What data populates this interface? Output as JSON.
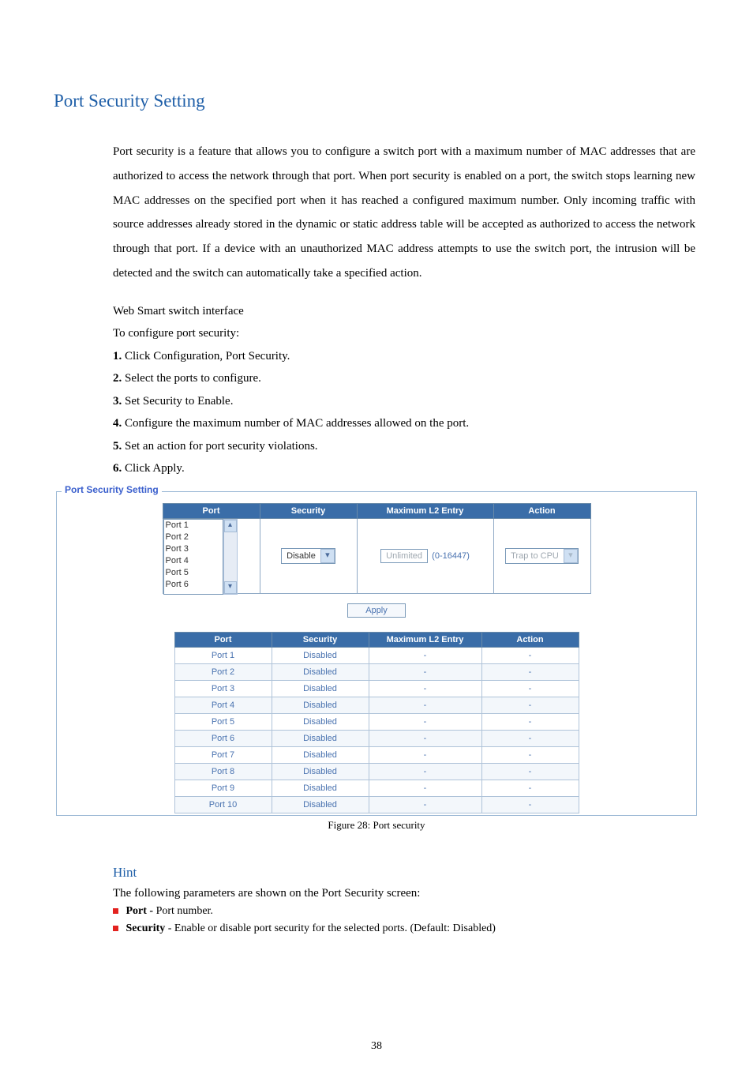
{
  "heading": "Port Security Setting",
  "intro": "Port security is a feature that allows you to configure a switch port with a maximum number of MAC addresses that are authorized to access the network through that port. When port security is enabled on a port, the switch stops learning new MAC addresses on the specified port when it has reached a configured maximum number. Only incoming traffic with source addresses already stored in the dynamic or static address table will be accepted as authorized to access the network through that port. If a device with an unauthorized MAC address attempts to use the switch port, the intrusion will be detected and the switch can automatically take a specified action.",
  "subhead1": "Web Smart switch interface",
  "subhead2": "To configure port security:",
  "steps": {
    "s1n": "1.",
    "s1": " Click Configuration, Port Security.",
    "s2n": "2.",
    "s2": " Select the ports to configure.",
    "s3n": "3.",
    "s3": " Set Security to Enable.",
    "s4n": "4.",
    "s4": " Configure the maximum number of MAC addresses allowed on the port.",
    "s5n": "5.",
    "s5": " Set an action for port security violations.",
    "s6n": "6.",
    "s6": " Click Apply."
  },
  "panel": {
    "legend": "Port Security Setting",
    "headers": {
      "port": "Port",
      "security": "Security",
      "max": "Maximum L2 Entry",
      "action": "Action"
    },
    "port_options": [
      "Port 1",
      "Port 2",
      "Port 3",
      "Port 4",
      "Port 5",
      "Port 6"
    ],
    "security_value": "Disable",
    "max_placeholder": "Unlimited",
    "range": "(0-16447)",
    "action_value": "Trap to CPU",
    "apply": "Apply"
  },
  "status": {
    "headers": {
      "port": "Port",
      "security": "Security",
      "max": "Maximum L2 Entry",
      "action": "Action"
    },
    "rows": [
      {
        "port": "Port 1",
        "security": "Disabled",
        "max": "-",
        "action": "-"
      },
      {
        "port": "Port 2",
        "security": "Disabled",
        "max": "-",
        "action": "-"
      },
      {
        "port": "Port 3",
        "security": "Disabled",
        "max": "-",
        "action": "-"
      },
      {
        "port": "Port 4",
        "security": "Disabled",
        "max": "-",
        "action": "-"
      },
      {
        "port": "Port 5",
        "security": "Disabled",
        "max": "-",
        "action": "-"
      },
      {
        "port": "Port 6",
        "security": "Disabled",
        "max": "-",
        "action": "-"
      },
      {
        "port": "Port 7",
        "security": "Disabled",
        "max": "-",
        "action": "-"
      },
      {
        "port": "Port 8",
        "security": "Disabled",
        "max": "-",
        "action": "-"
      },
      {
        "port": "Port 9",
        "security": "Disabled",
        "max": "-",
        "action": "-"
      },
      {
        "port": "Port 10",
        "security": "Disabled",
        "max": "-",
        "action": "-"
      }
    ]
  },
  "figure": "Figure 28: Port security",
  "hint": {
    "title": "Hint",
    "lead": "The following parameters are shown on the Port Security screen:",
    "b1_k": "Port - ",
    "b1_v": "Port number.",
    "b2_k": "Security",
    "b2_v": " - Enable or disable port security for the selected ports. (Default: Disabled)"
  },
  "page_number": "38"
}
